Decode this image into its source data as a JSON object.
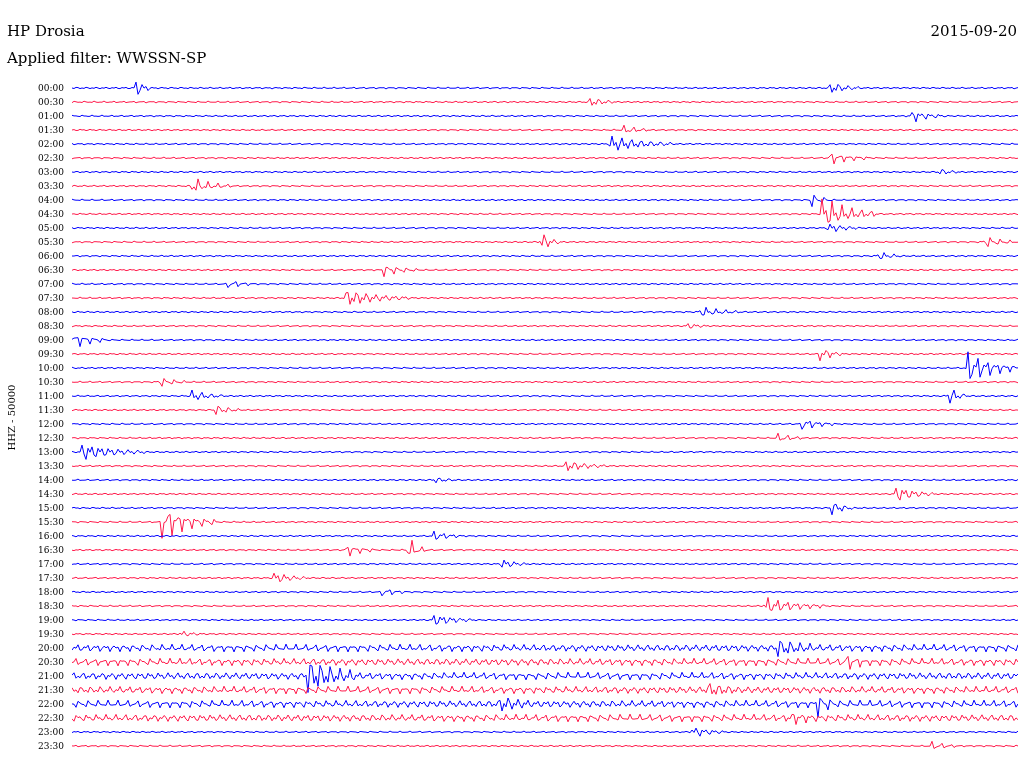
{
  "header": {
    "station": "HP Drosia",
    "filter": "Applied filter: WWSSN-SP",
    "date": "2015-09-20"
  },
  "axis_label": "HHZ - 50000",
  "rows": [
    {
      "time": "00:00",
      "color": "#0000ff"
    },
    {
      "time": "00:30",
      "color": "#ff1a4b"
    },
    {
      "time": "01:00",
      "color": "#0000ff"
    },
    {
      "time": "01:30",
      "color": "#ff1a4b"
    },
    {
      "time": "02:00",
      "color": "#0000ff"
    },
    {
      "time": "02:30",
      "color": "#ff1a4b"
    },
    {
      "time": "03:00",
      "color": "#0000ff"
    },
    {
      "time": "03:30",
      "color": "#ff1a4b"
    },
    {
      "time": "04:00",
      "color": "#0000ff"
    },
    {
      "time": "04:30",
      "color": "#ff1a4b"
    },
    {
      "time": "05:00",
      "color": "#0000ff"
    },
    {
      "time": "05:30",
      "color": "#ff1a4b"
    },
    {
      "time": "06:00",
      "color": "#0000ff"
    },
    {
      "time": "06:30",
      "color": "#ff1a4b"
    },
    {
      "time": "07:00",
      "color": "#0000ff"
    },
    {
      "time": "07:30",
      "color": "#ff1a4b"
    },
    {
      "time": "08:00",
      "color": "#0000ff"
    },
    {
      "time": "08:30",
      "color": "#ff1a4b"
    },
    {
      "time": "09:00",
      "color": "#0000ff"
    },
    {
      "time": "09:30",
      "color": "#ff1a4b"
    },
    {
      "time": "10:00",
      "color": "#0000ff"
    },
    {
      "time": "10:30",
      "color": "#ff1a4b"
    },
    {
      "time": "11:00",
      "color": "#0000ff"
    },
    {
      "time": "11:30",
      "color": "#ff1a4b"
    },
    {
      "time": "12:00",
      "color": "#0000ff"
    },
    {
      "time": "12:30",
      "color": "#ff1a4b"
    },
    {
      "time": "13:00",
      "color": "#0000ff"
    },
    {
      "time": "13:30",
      "color": "#ff1a4b"
    },
    {
      "time": "14:00",
      "color": "#0000ff"
    },
    {
      "time": "14:30",
      "color": "#ff1a4b"
    },
    {
      "time": "15:00",
      "color": "#0000ff"
    },
    {
      "time": "15:30",
      "color": "#ff1a4b"
    },
    {
      "time": "16:00",
      "color": "#0000ff"
    },
    {
      "time": "16:30",
      "color": "#ff1a4b"
    },
    {
      "time": "17:00",
      "color": "#0000ff"
    },
    {
      "time": "17:30",
      "color": "#ff1a4b"
    },
    {
      "time": "18:00",
      "color": "#0000ff"
    },
    {
      "time": "18:30",
      "color": "#ff1a4b"
    },
    {
      "time": "19:00",
      "color": "#0000ff"
    },
    {
      "time": "19:30",
      "color": "#ff1a4b"
    },
    {
      "time": "20:00",
      "color": "#0000ff"
    },
    {
      "time": "20:30",
      "color": "#ff1a4b"
    },
    {
      "time": "21:00",
      "color": "#0000ff"
    },
    {
      "time": "21:30",
      "color": "#ff1a4b"
    },
    {
      "time": "22:00",
      "color": "#0000ff"
    },
    {
      "time": "22:30",
      "color": "#ff1a4b"
    },
    {
      "time": "23:00",
      "color": "#0000ff"
    },
    {
      "time": "23:30",
      "color": "#ff1a4b"
    }
  ]
}
